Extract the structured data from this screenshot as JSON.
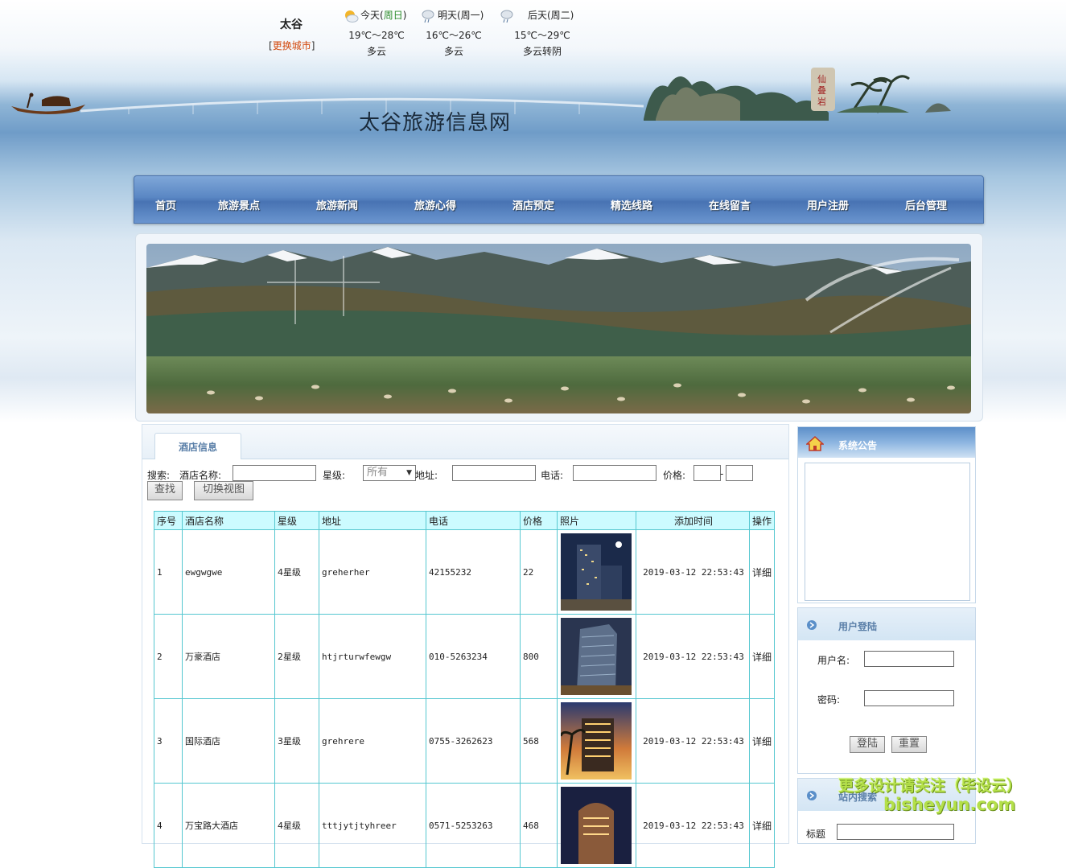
{
  "weather": {
    "city": "太谷",
    "change_city_open": "[",
    "change_city": "更换城市",
    "change_city_close": "]",
    "days": [
      {
        "label_pre": "今天(",
        "label_day": "周日",
        "label_post": ")",
        "temp": "19℃～28℃",
        "desc": "多云",
        "icon": "sun-cloud-icon"
      },
      {
        "label_pre": "明天(周一)",
        "label_day": "",
        "label_post": "",
        "temp": "16℃～26℃",
        "desc": "多云",
        "icon": "cloud-rain-icon"
      },
      {
        "label_pre": "后天(周二)",
        "label_day": "",
        "label_post": "",
        "temp": "15℃～29℃",
        "desc": "多云转阴",
        "icon": "cloud-rain-icon"
      }
    ]
  },
  "site_title": "太谷旅游信息网",
  "nav": [
    "首页",
    "旅游景点",
    "旅游新闻",
    "旅游心得",
    "酒店预定",
    "精选线路",
    "在线留言",
    "用户注册",
    "后台管理"
  ],
  "tab": "酒店信息",
  "search": {
    "label": "搜索:",
    "name_label": "酒店名称:",
    "star_label": "星级:",
    "star_value": "所有",
    "addr_label": "地址:",
    "phone_label": "电话:",
    "price_label": "价格:",
    "price_sep": "-",
    "find_button": "查找",
    "toggle_button": "切换视图"
  },
  "table": {
    "headers": [
      "序号",
      "酒店名称",
      "星级",
      "地址",
      "电话",
      "价格",
      "照片",
      "添加时间",
      "操作"
    ],
    "rows": [
      {
        "no": "1",
        "name": "ewgwgwe",
        "star": "4星级",
        "addr": "greherher",
        "phone": "42155232",
        "price": "22",
        "time": "2019-03-12 22:53:43",
        "op": "详细"
      },
      {
        "no": "2",
        "name": "万豪酒店",
        "star": "2星级",
        "addr": "htjrturwfewgw",
        "phone": "010-5263234",
        "price": "800",
        "time": "2019-03-12 22:53:43",
        "op": "详细"
      },
      {
        "no": "3",
        "name": "国际酒店",
        "star": "3星级",
        "addr": "grehrere",
        "phone": "0755-3262623",
        "price": "568",
        "time": "2019-03-12 22:53:43",
        "op": "详细"
      },
      {
        "no": "4",
        "name": "万宝路大酒店",
        "star": "4星级",
        "addr": "tttjytjtyhreer",
        "phone": "0571-5253263",
        "price": "468",
        "time": "2019-03-12 22:53:43",
        "op": "详细"
      }
    ]
  },
  "sidebar": {
    "notice_title": "系统公告",
    "login_title": "用户登陆",
    "username_label": "用户名:",
    "password_label": "密码:",
    "login_button": "登陆",
    "reset_button": "重置",
    "site_search_title": "站内搜索",
    "search_title_label": "标题"
  },
  "watermark": {
    "line1": "更多设计请关注（毕设云）",
    "line2": "bisheyun.com"
  },
  "colors": {
    "nav_bg": "#5a87c4",
    "table_border": "#55c7d0",
    "table_header_bg": "#ccfbff",
    "accent_link": "#d2480c",
    "watermark": "#b4e04a"
  }
}
